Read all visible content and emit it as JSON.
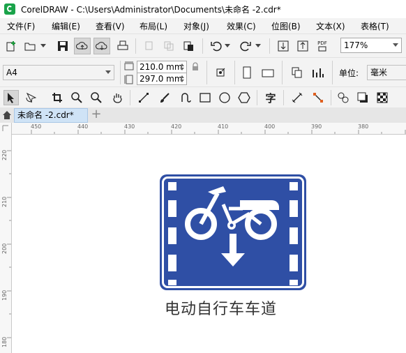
{
  "window": {
    "title": "CorelDRAW - C:\\Users\\Administrator\\Documents\\未命名 -2.cdr*"
  },
  "menu": [
    "文件(F)",
    "编辑(E)",
    "查看(V)",
    "布局(L)",
    "对象(J)",
    "效果(C)",
    "位图(B)",
    "文本(X)",
    "表格(T)"
  ],
  "standard_toolbar": {
    "zoom_value": "177%",
    "pdf_label": "PDF"
  },
  "property_bar": {
    "page_size": "A4",
    "width": "210.0 mm",
    "height": "297.0 mm",
    "units_label": "单位:",
    "units_value": "毫米"
  },
  "toolbox": {
    "text_tool_glyph": "字"
  },
  "tabs": {
    "document": "未命名 -2.cdr*"
  },
  "ruler": {
    "horizontal_ticks": [
      "450",
      "440",
      "430",
      "420",
      "410",
      "400",
      "390",
      "380"
    ],
    "vertical_ticks": [
      "220",
      "210",
      "200",
      "190",
      "180"
    ]
  },
  "document": {
    "sign_caption": "电动自行车车道",
    "sign_color": "#2f4fa5"
  }
}
